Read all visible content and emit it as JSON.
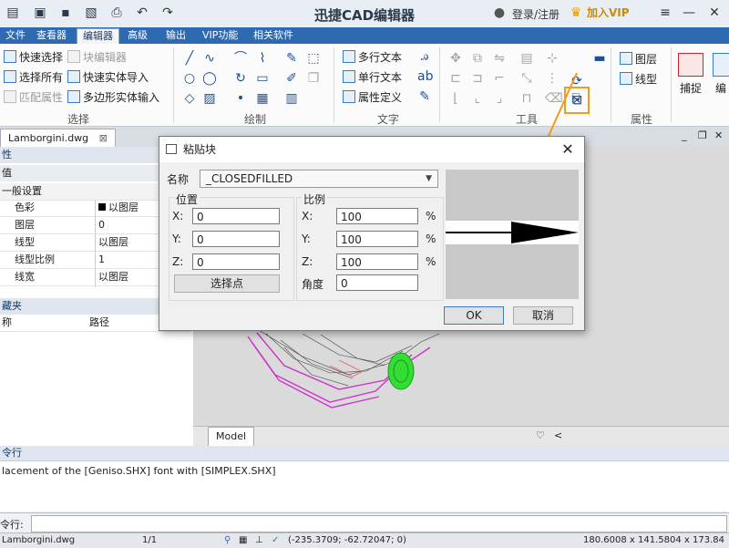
{
  "window": {
    "app_title": "迅捷CAD编辑器",
    "login_label": "登录/注册",
    "vip_label": "加入VIP"
  },
  "ribbon_tabs": [
    "文件",
    "查看器",
    "编辑器",
    "高级",
    "输出",
    "VIP功能",
    "相关软件"
  ],
  "active_tab_index": 2,
  "ribbon": {
    "select_group": {
      "label": "选择",
      "buttons": [
        "快速选择",
        "选择所有",
        "匹配属性",
        "块编辑器",
        "快速实体导入",
        "多边形实体输入"
      ]
    },
    "draw_group": {
      "label": "绘制"
    },
    "text_group": {
      "label": "文字",
      "buttons": [
        "多行文本",
        "单行文本",
        "属性定义"
      ]
    },
    "tools_group": {
      "label": "工具"
    },
    "props_group": {
      "label": "属性",
      "buttons": [
        "图层",
        "线型"
      ]
    },
    "snap_label": "捕捉",
    "edit_label": "编"
  },
  "doc_tab": "Lamborgini.dwg",
  "properties_panel": {
    "header": "性",
    "value_header": "值",
    "section": "一般设置",
    "rows": [
      {
        "key": "色彩",
        "value": "以图层"
      },
      {
        "key": "图层",
        "value": "0"
      },
      {
        "key": "线型",
        "value": "以图层"
      },
      {
        "key": "线型比例",
        "value": "1"
      },
      {
        "key": "线宽",
        "value": "以图层"
      }
    ],
    "folder_header": "藏夹",
    "col_name": "称",
    "col_path": "路径"
  },
  "model_tab": "Model",
  "command": {
    "header": "令行",
    "output": "lacement of the [Geniso.SHX] font with [SIMPLEX.SHX]",
    "input_label": "令行:"
  },
  "status_bar": {
    "file": "Lamborgini.dwg",
    "page": "1/1",
    "coords": "(-235.3709; -62.72047; 0)",
    "size": "180.6008 x 141.5804 x 173.84"
  },
  "dialog": {
    "title": "粘贴块",
    "name_label": "名称",
    "name_value": "_CLOSEDFILLED",
    "position_label": "位置",
    "scale_label": "比例",
    "pos": [
      {
        "axis": "X:",
        "value": "0"
      },
      {
        "axis": "Y:",
        "value": "0"
      },
      {
        "axis": "Z:",
        "value": "0"
      }
    ],
    "scale": [
      {
        "axis": "X:",
        "value": "100",
        "unit": "%"
      },
      {
        "axis": "Y:",
        "value": "100",
        "unit": "%"
      },
      {
        "axis": "Z:",
        "value": "100",
        "unit": "%"
      }
    ],
    "pick_point": "选择点",
    "angle_label": "角度",
    "angle_value": "0",
    "ok": "OK",
    "cancel": "取消"
  },
  "colors": {
    "accent": "#2e6ab1",
    "highlight": "#f39b1f",
    "car_wire": "#cc33cc",
    "wheel": "#33dd33"
  }
}
